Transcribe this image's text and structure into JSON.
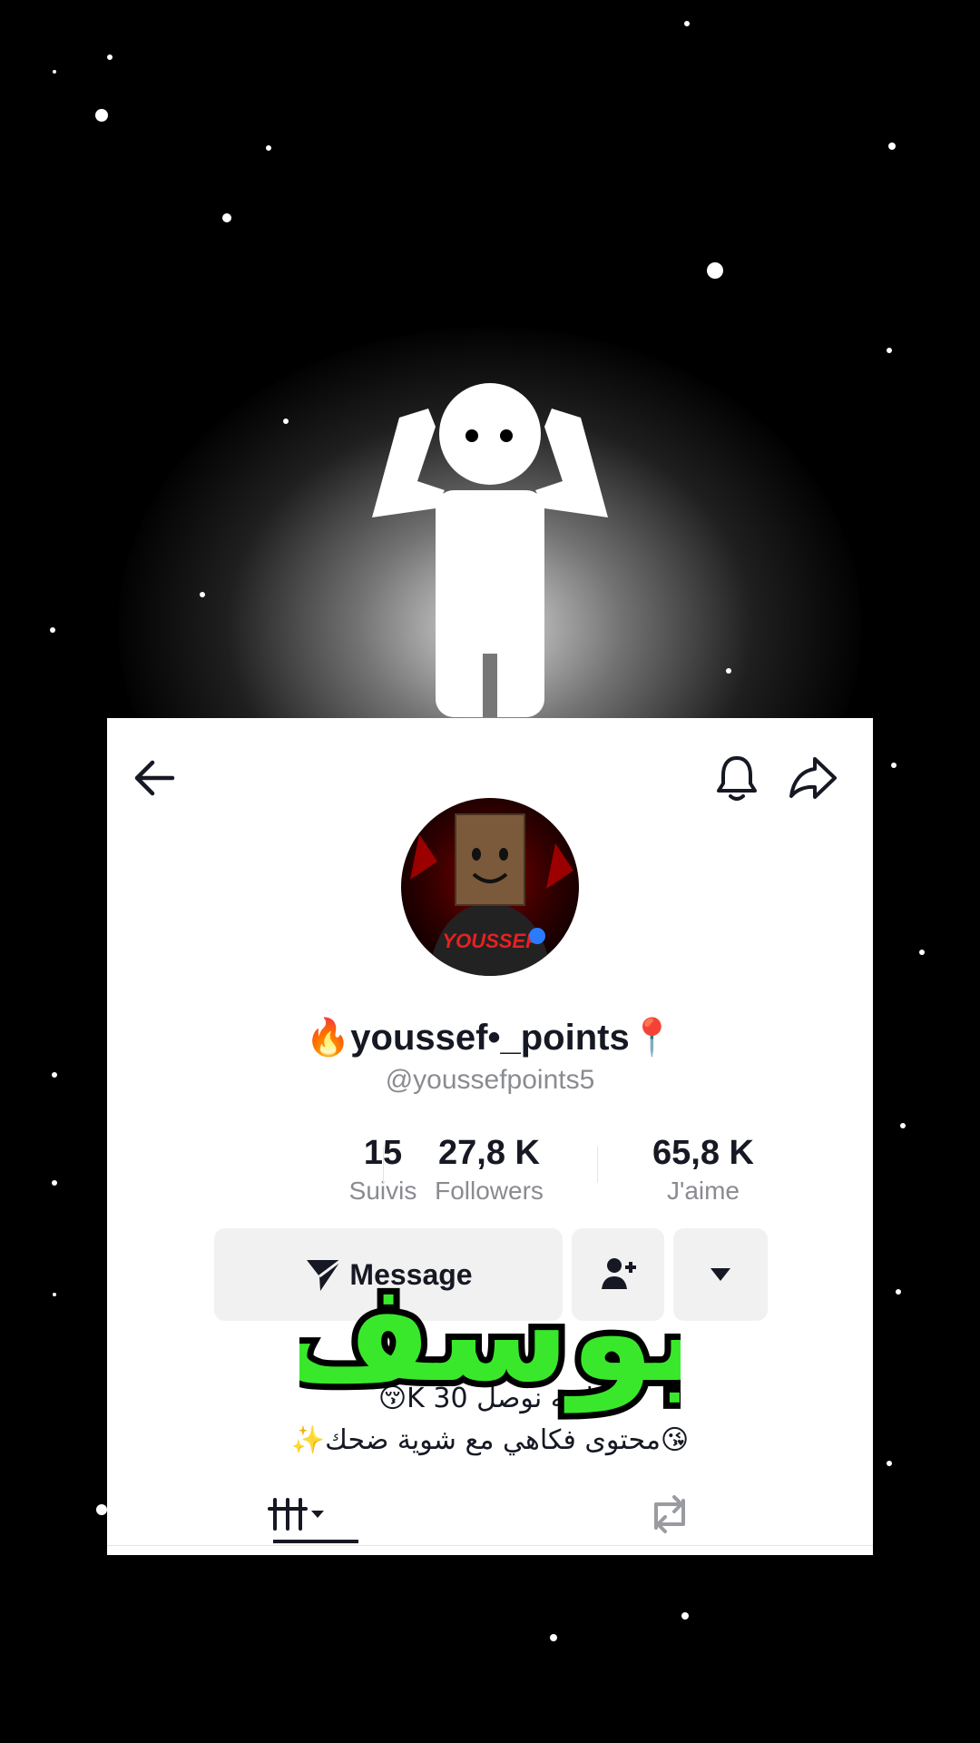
{
  "profile": {
    "display_name": "🔥youssef•_points📍",
    "handle": "@youssefpoints5",
    "avatar_text": "YOUSSEF"
  },
  "stats": [
    {
      "value": "15",
      "label": "Suivis"
    },
    {
      "value": "27,8 K",
      "label": "Followers"
    },
    {
      "value": "65,8 K",
      "label": "J'aime"
    }
  ],
  "actions": {
    "message_label": "Message"
  },
  "bio": {
    "line1": "تابعه نوصل 30 K😚",
    "line2": "😘محتوى فكاهي مع شوية ضحك✨"
  },
  "overlay": {
    "text": "يوسف",
    "color": "#39e82b"
  },
  "icons": [
    "back-arrow-icon",
    "bell-icon",
    "share-icon",
    "send-icon",
    "add-friend-icon",
    "dropdown-icon",
    "grid-icon",
    "repost-icon"
  ]
}
